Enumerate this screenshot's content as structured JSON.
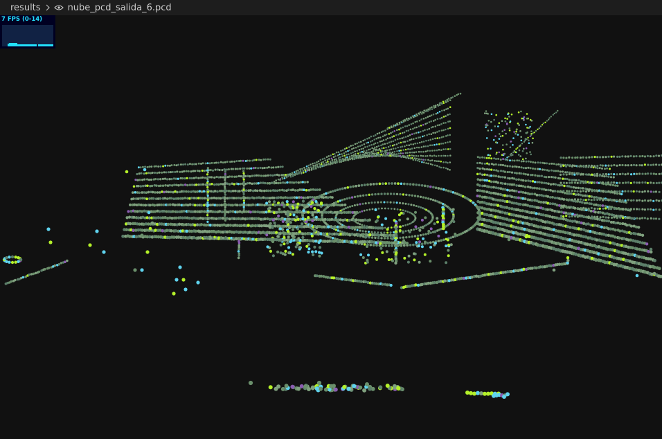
{
  "breadcrumb": {
    "folder": "results",
    "file": "nube_pcd_salida_6.pcd",
    "separator_icon": "chevron-right-icon",
    "file_icon": "eye-icon"
  },
  "stats": {
    "fps_label": "7 FPS (0-14)",
    "text_color": "#22e0ff",
    "panel_bg": "#000022",
    "graph_bg": "#112244"
  },
  "viewport": {
    "background": "#111111",
    "point_colors": [
      "#6a8f6b",
      "#7fa07e",
      "#5c7f6a",
      "#b4f02a",
      "#5fd3ee",
      "#8a5cb0"
    ]
  }
}
